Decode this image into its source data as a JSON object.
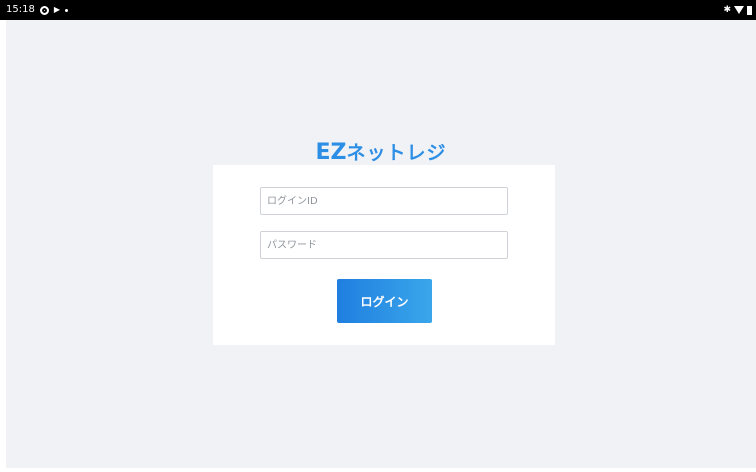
{
  "status_bar": {
    "time": "15:18"
  },
  "app": {
    "logo_ez": "EZ",
    "logo_rest": "ネットレジ",
    "brand_color": "#2d8ee6"
  },
  "login_form": {
    "login_id_placeholder": "ログインID",
    "password_placeholder": "パスワード",
    "login_button_label": "ログイン",
    "button_color": "#2a8fe6"
  },
  "colors": {
    "background": "#f0f2f6",
    "card": "#ffffff",
    "status_bar": "#000000"
  }
}
